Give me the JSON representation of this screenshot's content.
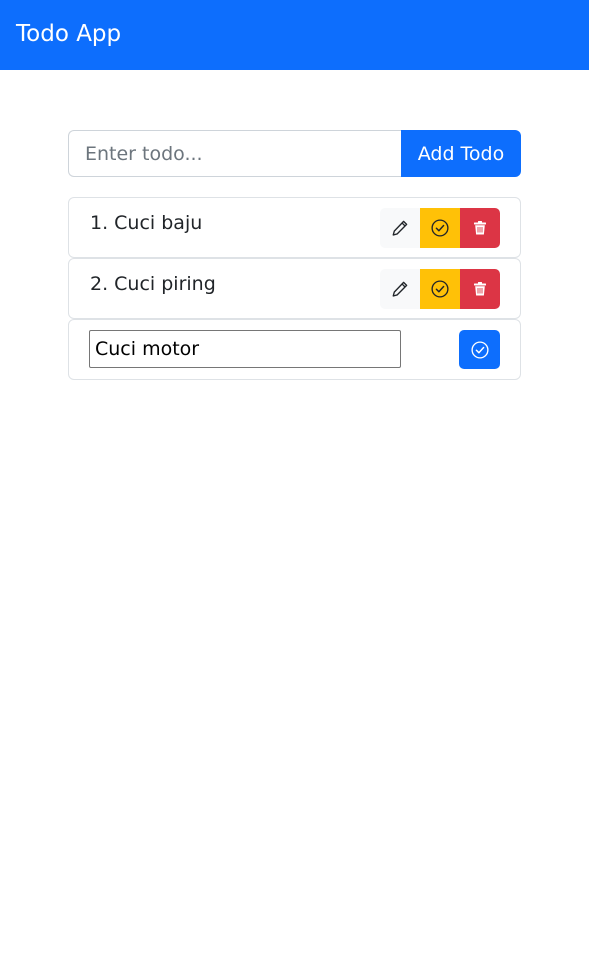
{
  "navbar": {
    "brand": "Todo App"
  },
  "form": {
    "placeholder": "Enter todo...",
    "value": "",
    "add_label": "Add Todo"
  },
  "todos": [
    {
      "text": "1. Cuci baju",
      "edit_icon": "pencil-icon",
      "done_icon": "check-circle-icon",
      "delete_icon": "trash-icon"
    },
    {
      "text": "2. Cuci piring",
      "edit_icon": "pencil-icon",
      "done_icon": "check-circle-icon",
      "delete_icon": "trash-icon"
    }
  ],
  "editing": {
    "value": "Cuci motor",
    "save_icon": "check-circle-icon"
  },
  "colors": {
    "primary": "#0d6efd",
    "warning": "#ffc107",
    "danger": "#dc3545",
    "light": "#f8f9fa"
  }
}
